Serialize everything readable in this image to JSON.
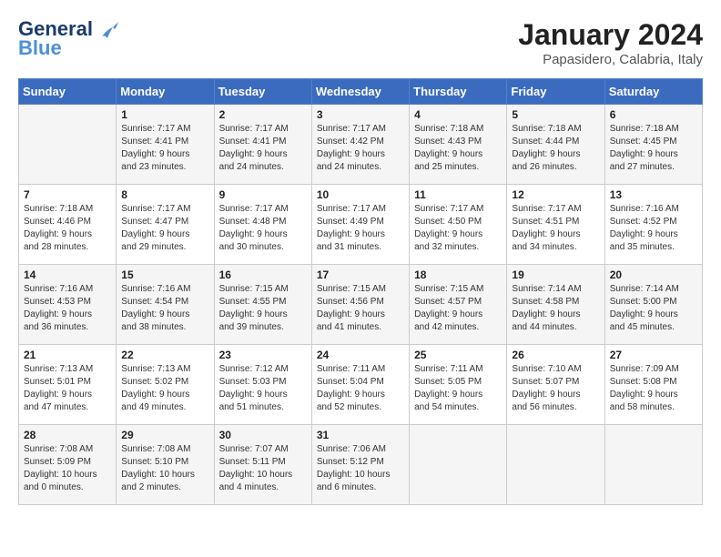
{
  "header": {
    "logo_line1": "General",
    "logo_line2": "Blue",
    "month": "January 2024",
    "location": "Papasidero, Calabria, Italy"
  },
  "days_of_week": [
    "Sunday",
    "Monday",
    "Tuesday",
    "Wednesday",
    "Thursday",
    "Friday",
    "Saturday"
  ],
  "weeks": [
    [
      {
        "num": "",
        "text": ""
      },
      {
        "num": "1",
        "text": "Sunrise: 7:17 AM\nSunset: 4:41 PM\nDaylight: 9 hours\nand 23 minutes."
      },
      {
        "num": "2",
        "text": "Sunrise: 7:17 AM\nSunset: 4:41 PM\nDaylight: 9 hours\nand 24 minutes."
      },
      {
        "num": "3",
        "text": "Sunrise: 7:17 AM\nSunset: 4:42 PM\nDaylight: 9 hours\nand 24 minutes."
      },
      {
        "num": "4",
        "text": "Sunrise: 7:18 AM\nSunset: 4:43 PM\nDaylight: 9 hours\nand 25 minutes."
      },
      {
        "num": "5",
        "text": "Sunrise: 7:18 AM\nSunset: 4:44 PM\nDaylight: 9 hours\nand 26 minutes."
      },
      {
        "num": "6",
        "text": "Sunrise: 7:18 AM\nSunset: 4:45 PM\nDaylight: 9 hours\nand 27 minutes."
      }
    ],
    [
      {
        "num": "7",
        "text": "Sunrise: 7:18 AM\nSunset: 4:46 PM\nDaylight: 9 hours\nand 28 minutes."
      },
      {
        "num": "8",
        "text": "Sunrise: 7:17 AM\nSunset: 4:47 PM\nDaylight: 9 hours\nand 29 minutes."
      },
      {
        "num": "9",
        "text": "Sunrise: 7:17 AM\nSunset: 4:48 PM\nDaylight: 9 hours\nand 30 minutes."
      },
      {
        "num": "10",
        "text": "Sunrise: 7:17 AM\nSunset: 4:49 PM\nDaylight: 9 hours\nand 31 minutes."
      },
      {
        "num": "11",
        "text": "Sunrise: 7:17 AM\nSunset: 4:50 PM\nDaylight: 9 hours\nand 32 minutes."
      },
      {
        "num": "12",
        "text": "Sunrise: 7:17 AM\nSunset: 4:51 PM\nDaylight: 9 hours\nand 34 minutes."
      },
      {
        "num": "13",
        "text": "Sunrise: 7:16 AM\nSunset: 4:52 PM\nDaylight: 9 hours\nand 35 minutes."
      }
    ],
    [
      {
        "num": "14",
        "text": "Sunrise: 7:16 AM\nSunset: 4:53 PM\nDaylight: 9 hours\nand 36 minutes."
      },
      {
        "num": "15",
        "text": "Sunrise: 7:16 AM\nSunset: 4:54 PM\nDaylight: 9 hours\nand 38 minutes."
      },
      {
        "num": "16",
        "text": "Sunrise: 7:15 AM\nSunset: 4:55 PM\nDaylight: 9 hours\nand 39 minutes."
      },
      {
        "num": "17",
        "text": "Sunrise: 7:15 AM\nSunset: 4:56 PM\nDaylight: 9 hours\nand 41 minutes."
      },
      {
        "num": "18",
        "text": "Sunrise: 7:15 AM\nSunset: 4:57 PM\nDaylight: 9 hours\nand 42 minutes."
      },
      {
        "num": "19",
        "text": "Sunrise: 7:14 AM\nSunset: 4:58 PM\nDaylight: 9 hours\nand 44 minutes."
      },
      {
        "num": "20",
        "text": "Sunrise: 7:14 AM\nSunset: 5:00 PM\nDaylight: 9 hours\nand 45 minutes."
      }
    ],
    [
      {
        "num": "21",
        "text": "Sunrise: 7:13 AM\nSunset: 5:01 PM\nDaylight: 9 hours\nand 47 minutes."
      },
      {
        "num": "22",
        "text": "Sunrise: 7:13 AM\nSunset: 5:02 PM\nDaylight: 9 hours\nand 49 minutes."
      },
      {
        "num": "23",
        "text": "Sunrise: 7:12 AM\nSunset: 5:03 PM\nDaylight: 9 hours\nand 51 minutes."
      },
      {
        "num": "24",
        "text": "Sunrise: 7:11 AM\nSunset: 5:04 PM\nDaylight: 9 hours\nand 52 minutes."
      },
      {
        "num": "25",
        "text": "Sunrise: 7:11 AM\nSunset: 5:05 PM\nDaylight: 9 hours\nand 54 minutes."
      },
      {
        "num": "26",
        "text": "Sunrise: 7:10 AM\nSunset: 5:07 PM\nDaylight: 9 hours\nand 56 minutes."
      },
      {
        "num": "27",
        "text": "Sunrise: 7:09 AM\nSunset: 5:08 PM\nDaylight: 9 hours\nand 58 minutes."
      }
    ],
    [
      {
        "num": "28",
        "text": "Sunrise: 7:08 AM\nSunset: 5:09 PM\nDaylight: 10 hours\nand 0 minutes."
      },
      {
        "num": "29",
        "text": "Sunrise: 7:08 AM\nSunset: 5:10 PM\nDaylight: 10 hours\nand 2 minutes."
      },
      {
        "num": "30",
        "text": "Sunrise: 7:07 AM\nSunset: 5:11 PM\nDaylight: 10 hours\nand 4 minutes."
      },
      {
        "num": "31",
        "text": "Sunrise: 7:06 AM\nSunset: 5:12 PM\nDaylight: 10 hours\nand 6 minutes."
      },
      {
        "num": "",
        "text": ""
      },
      {
        "num": "",
        "text": ""
      },
      {
        "num": "",
        "text": ""
      }
    ]
  ]
}
